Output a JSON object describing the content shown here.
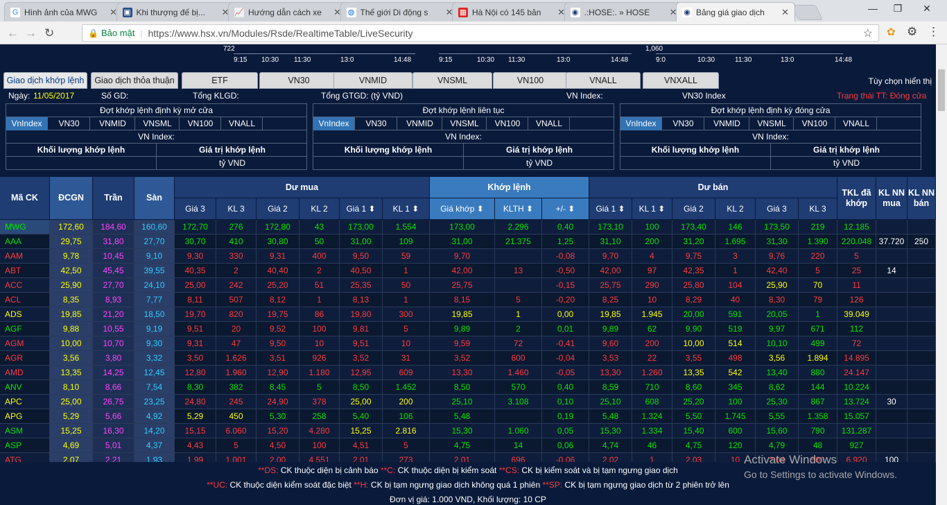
{
  "browser": {
    "tabs": [
      {
        "title": "Hình ảnh của MWG",
        "icon": "google-g-icon",
        "active": false
      },
      {
        "title": "Khi thượng đế bị...",
        "icon": "news-icon",
        "active": false
      },
      {
        "title": "Hướng dẫn cách xe",
        "icon": "chart-icon",
        "active": false
      },
      {
        "title": "Thế giới Di động s",
        "icon": "globe-icon",
        "active": false
      },
      {
        "title": "Hà Nội có 145 bản",
        "icon": "news-red-icon",
        "active": false
      },
      {
        "title": ".:HOSE:. » HOSE",
        "icon": "hose-icon",
        "active": false
      },
      {
        "title": "Bảng giá giao dịch",
        "icon": "hose-icon",
        "active": true
      }
    ],
    "security_label": "Bảo mật",
    "url": "https://www.hsx.vn/Modules/Rsde/RealtimeTable/LiveSecurity"
  },
  "charts": [
    {
      "ylabel": "722",
      "ticks": [
        "9:15",
        "10:30",
        "11:30",
        "13:0",
        "14:48"
      ]
    },
    {
      "ylabel": "",
      "ticks": [
        "9:15",
        "10:30",
        "11:30",
        "13:0",
        "14:48"
      ]
    },
    {
      "ylabel": "1,060",
      "ticks": [
        "9:0",
        "10:30",
        "11:30",
        "13:0",
        "14:48"
      ]
    }
  ],
  "index_tabs": [
    "Giao dịch khớp lệnh",
    "Giao dịch thỏa thuận",
    "ETF",
    "VN30",
    "VNMID",
    "VNSML",
    "VN100",
    "VNALL",
    "VNXALL"
  ],
  "display_options": "Tùy chọn hiển thị",
  "info": {
    "date_label": "Ngày:",
    "date_value": "11/05/2017",
    "session_label": "Số GD:",
    "total_vol_label": "Tổng KLGD:",
    "total_val_label": "Tổng GTGD:  (tỷ VND)",
    "vnindex_label": "VN Index:",
    "vn30_label": "VN30 Index",
    "market_status": "Trạng thái TT: Đóng cửa"
  },
  "periods": [
    {
      "title": "Đợt khớp lệnh định kỳ mở cửa"
    },
    {
      "title": "Đợt khớp lệnh liên tục"
    },
    {
      "title": "Đợt khớp lệnh định kỳ đóng cửa"
    }
  ],
  "period_tabs": [
    "VnIndex",
    "VN30",
    "VNMID",
    "VNSML",
    "VN100",
    "VNALL"
  ],
  "period_labels": {
    "index": "VN Index:",
    "vol": "Khối lượng khớp lệnh",
    "val": "Giá trị khớp lệnh",
    "unit": "tỷ VND"
  },
  "board": {
    "head": {
      "ma": "Mã CK",
      "dcgn": "ĐCGN",
      "tran": "Trần",
      "san": "Sàn",
      "dumua": "Dư mua",
      "khop": "Khớp lệnh",
      "duban": "Dư bán",
      "tkl": "TKL đã khớp",
      "nnmua": "KL NN mua",
      "nnban": "KL NN bán"
    },
    "subhead": [
      "Giá 3",
      "KL 3",
      "Giá 2",
      "KL 2",
      "Giá 1 ⬍",
      "KL 1 ⬍",
      "Giá khớp ⬍",
      "KLTH ⬍",
      "+/- ⬍",
      "Giá 1 ⬍",
      "KL 1 ⬍",
      "Giá 2",
      "KL 2",
      "Giá 3",
      "KL 3"
    ],
    "rows": [
      {
        "c": [
          "MWG",
          "172,60",
          "184,60",
          "160,60",
          "172,70",
          "276",
          "172,80",
          "43",
          "173,00",
          "1.554",
          "173,00",
          "2.296",
          "0,40",
          "173,10",
          "100",
          "173,40",
          "146",
          "173,50",
          "219",
          "12.185",
          "",
          ""
        ],
        "k": [
          "g",
          "y",
          "m",
          "c",
          "g",
          "g",
          "g",
          "g",
          "g",
          "g",
          "g",
          "g",
          "g",
          "g",
          "g",
          "g",
          "g",
          "g",
          "g",
          "g",
          "w",
          "w"
        ]
      },
      {
        "c": [
          "AAA",
          "29,75",
          "31,80",
          "27,70",
          "30,70",
          "410",
          "30,80",
          "50",
          "31,00",
          "109",
          "31,00",
          "21.375",
          "1,25",
          "31,10",
          "200",
          "31,20",
          "1.695",
          "31,30",
          "1.390",
          "220.048",
          "37.720",
          "250"
        ],
        "k": [
          "g",
          "y",
          "m",
          "c",
          "g",
          "g",
          "g",
          "g",
          "g",
          "g",
          "g",
          "g",
          "g",
          "g",
          "g",
          "g",
          "g",
          "g",
          "g",
          "g",
          "w",
          "w"
        ]
      },
      {
        "c": [
          "AAM",
          "9,78",
          "10,45",
          "9,10",
          "9,30",
          "330",
          "9,31",
          "400",
          "9,50",
          "59",
          "9,70",
          "",
          "-0,08",
          "9,70",
          "4",
          "9,75",
          "3",
          "9,76",
          "220",
          "5",
          "",
          ""
        ],
        "k": [
          "r",
          "y",
          "m",
          "c",
          "r",
          "r",
          "r",
          "r",
          "r",
          "r",
          "r",
          "r",
          "r",
          "r",
          "r",
          "r",
          "r",
          "r",
          "r",
          "r",
          "w",
          "w"
        ]
      },
      {
        "c": [
          "ABT",
          "42,50",
          "45,45",
          "39,55",
          "40,35",
          "2",
          "40,40",
          "2",
          "40,50",
          "1",
          "42,00",
          "13",
          "-0,50",
          "42,00",
          "97",
          "42,35",
          "1",
          "42,40",
          "5",
          "25",
          "14",
          ""
        ],
        "k": [
          "r",
          "y",
          "m",
          "c",
          "r",
          "r",
          "r",
          "r",
          "r",
          "r",
          "r",
          "r",
          "r",
          "r",
          "r",
          "r",
          "r",
          "r",
          "r",
          "r",
          "w",
          "w"
        ]
      },
      {
        "c": [
          "ACC",
          "25,90",
          "27,70",
          "24,10",
          "25,00",
          "242",
          "25,20",
          "51",
          "25,35",
          "50",
          "25,75",
          "",
          "-0,15",
          "25,75",
          "290",
          "25,80",
          "104",
          "25,90",
          "70",
          "11",
          "",
          ""
        ],
        "k": [
          "r",
          "y",
          "m",
          "c",
          "r",
          "r",
          "r",
          "r",
          "r",
          "r",
          "r",
          "r",
          "r",
          "r",
          "r",
          "r",
          "r",
          "y",
          "y",
          "r",
          "w",
          "w"
        ]
      },
      {
        "c": [
          "ACL",
          "8,35",
          "8,93",
          "7,77",
          "8,11",
          "507",
          "8,12",
          "1",
          "8,13",
          "1",
          "8,15",
          "5",
          "-0,20",
          "8,25",
          "10",
          "8,29",
          "40",
          "8,30",
          "79",
          "126",
          "",
          ""
        ],
        "k": [
          "r",
          "y",
          "m",
          "c",
          "r",
          "r",
          "r",
          "r",
          "r",
          "r",
          "r",
          "r",
          "r",
          "r",
          "r",
          "r",
          "r",
          "r",
          "r",
          "r",
          "w",
          "w"
        ]
      },
      {
        "c": [
          "ADS",
          "19,85",
          "21,20",
          "18,50",
          "19,70",
          "820",
          "19,75",
          "86",
          "19,80",
          "300",
          "19,85",
          "1",
          "0,00",
          "19,85",
          "1.945",
          "20,00",
          "591",
          "20,05",
          "1",
          "39.049",
          "",
          ""
        ],
        "k": [
          "y",
          "y",
          "m",
          "c",
          "r",
          "r",
          "r",
          "r",
          "r",
          "r",
          "y",
          "y",
          "y",
          "y",
          "y",
          "g",
          "g",
          "g",
          "g",
          "y",
          "w",
          "w"
        ]
      },
      {
        "c": [
          "AGF",
          "9,88",
          "10,55",
          "9,19",
          "9,51",
          "20",
          "9,52",
          "100",
          "9,81",
          "5",
          "9,89",
          "2",
          "0,01",
          "9,89",
          "62",
          "9,90",
          "519",
          "9,97",
          "671",
          "112",
          "",
          ""
        ],
        "k": [
          "g",
          "y",
          "m",
          "c",
          "r",
          "r",
          "r",
          "r",
          "r",
          "r",
          "g",
          "g",
          "g",
          "g",
          "g",
          "g",
          "g",
          "g",
          "g",
          "g",
          "w",
          "w"
        ]
      },
      {
        "c": [
          "AGM",
          "10,00",
          "10,70",
          "9,30",
          "9,31",
          "47",
          "9,50",
          "10",
          "9,51",
          "10",
          "9,59",
          "72",
          "-0,41",
          "9,60",
          "200",
          "10,00",
          "514",
          "10,10",
          "499",
          "72",
          "",
          ""
        ],
        "k": [
          "r",
          "y",
          "m",
          "c",
          "r",
          "r",
          "r",
          "r",
          "r",
          "r",
          "r",
          "r",
          "r",
          "r",
          "r",
          "y",
          "y",
          "g",
          "g",
          "r",
          "w",
          "w"
        ]
      },
      {
        "c": [
          "AGR",
          "3,56",
          "3,80",
          "3,32",
          "3,50",
          "1.626",
          "3,51",
          "926",
          "3,52",
          "31",
          "3,52",
          "600",
          "-0,04",
          "3,53",
          "22",
          "3,55",
          "498",
          "3,56",
          "1.894",
          "14.895",
          "",
          ""
        ],
        "k": [
          "r",
          "y",
          "m",
          "c",
          "r",
          "r",
          "r",
          "r",
          "r",
          "r",
          "r",
          "r",
          "r",
          "r",
          "r",
          "r",
          "r",
          "y",
          "y",
          "r",
          "w",
          "w"
        ]
      },
      {
        "c": [
          "AMD",
          "13,35",
          "14,25",
          "12,45",
          "12,80",
          "1.960",
          "12,90",
          "1.180",
          "12,95",
          "609",
          "13,30",
          "1.460",
          "-0,05",
          "13,30",
          "1.260",
          "13,35",
          "542",
          "13,40",
          "880",
          "24.147",
          "",
          ""
        ],
        "k": [
          "r",
          "y",
          "m",
          "c",
          "r",
          "r",
          "r",
          "r",
          "r",
          "r",
          "r",
          "r",
          "r",
          "r",
          "r",
          "y",
          "y",
          "g",
          "g",
          "r",
          "w",
          "w"
        ]
      },
      {
        "c": [
          "ANV",
          "8,10",
          "8,66",
          "7,54",
          "8,30",
          "382",
          "8,45",
          "5",
          "8,50",
          "1.452",
          "8,50",
          "570",
          "0,40",
          "8,59",
          "710",
          "8,60",
          "345",
          "8,62",
          "144",
          "10.224",
          "",
          ""
        ],
        "k": [
          "g",
          "y",
          "m",
          "c",
          "g",
          "g",
          "g",
          "g",
          "g",
          "g",
          "g",
          "g",
          "g",
          "g",
          "g",
          "g",
          "g",
          "g",
          "g",
          "g",
          "w",
          "w"
        ]
      },
      {
        "c": [
          "APC",
          "25,00",
          "26,75",
          "23,25",
          "24,80",
          "245",
          "24,90",
          "378",
          "25,00",
          "200",
          "25,10",
          "3.108",
          "0,10",
          "25,10",
          "608",
          "25,20",
          "100",
          "25,30",
          "867",
          "13.724",
          "30",
          ""
        ],
        "k": [
          "y",
          "y",
          "m",
          "c",
          "r",
          "r",
          "r",
          "r",
          "y",
          "y",
          "g",
          "g",
          "g",
          "g",
          "g",
          "g",
          "g",
          "g",
          "g",
          "g",
          "w",
          "w"
        ]
      },
      {
        "c": [
          "APG",
          "5,29",
          "5,66",
          "4,92",
          "5,29",
          "450",
          "5,30",
          "258",
          "5,40",
          "106",
          "5,48",
          "",
          "0,19",
          "5,48",
          "1.324",
          "5,50",
          "1.745",
          "5,55",
          "1.358",
          "15.057",
          "",
          ""
        ],
        "k": [
          "y",
          "y",
          "m",
          "c",
          "y",
          "y",
          "g",
          "g",
          "g",
          "g",
          "g",
          "g",
          "g",
          "g",
          "g",
          "g",
          "g",
          "g",
          "g",
          "g",
          "w",
          "w"
        ]
      },
      {
        "c": [
          "ASM",
          "15,25",
          "16,30",
          "14,20",
          "15,15",
          "6.060",
          "15,20",
          "4.280",
          "15,25",
          "2.816",
          "15,30",
          "1.060",
          "0,05",
          "15,30",
          "1.334",
          "15,40",
          "600",
          "15,60",
          "790",
          "131.287",
          "",
          ""
        ],
        "k": [
          "g",
          "y",
          "m",
          "c",
          "r",
          "r",
          "r",
          "r",
          "y",
          "y",
          "g",
          "g",
          "g",
          "g",
          "g",
          "g",
          "g",
          "g",
          "g",
          "g",
          "w",
          "w"
        ]
      },
      {
        "c": [
          "ASP",
          "4,69",
          "5,01",
          "4,37",
          "4,43",
          "5",
          "4,50",
          "100",
          "4,51",
          "5",
          "4,75",
          "14",
          "0,06",
          "4,74",
          "46",
          "4,75",
          "120",
          "4,79",
          "48",
          "927",
          "",
          ""
        ],
        "k": [
          "g",
          "y",
          "m",
          "c",
          "r",
          "r",
          "r",
          "r",
          "r",
          "r",
          "g",
          "g",
          "g",
          "g",
          "g",
          "g",
          "g",
          "g",
          "g",
          "g",
          "w",
          "w"
        ]
      },
      {
        "c": [
          "ATG",
          "2,07",
          "2,21",
          "1,93",
          "1,99",
          "1.001",
          "2,00",
          "4.551",
          "2,01",
          "273",
          "2,01",
          "696",
          "-0,06",
          "2,02",
          "1",
          "2,03",
          "10",
          "2,04",
          "500",
          "6.920",
          "100",
          ""
        ],
        "k": [
          "r",
          "y",
          "m",
          "c",
          "r",
          "r",
          "r",
          "r",
          "r",
          "r",
          "r",
          "r",
          "r",
          "r",
          "r",
          "r",
          "r",
          "r",
          "r",
          "r",
          "w",
          "w"
        ]
      }
    ]
  },
  "legend": {
    "l1": [
      {
        "m": "**DS:",
        "t": " CK thuộc diện bị cảnh báo "
      },
      {
        "m": "**C:",
        "t": " CK thuộc diện bị kiểm soát "
      },
      {
        "m": "**CS:",
        "t": " CK bị kiểm soát và bị tạm ngưng giao dịch"
      }
    ],
    "l2": [
      {
        "m": "**UC:",
        "t": " CK thuộc diện kiểm soát đặc biệt "
      },
      {
        "m": "**H:",
        "t": " CK bị tạm ngưng giao dịch không quá 1 phiên "
      },
      {
        "m": "**SP:",
        "t": " CK bị tạm ngưng giao dịch từ 2 phiên trở lên"
      }
    ],
    "l3": "Đơn vị giá: 1.000 VND, Khối lượng: 10 CP"
  },
  "watermark": {
    "line1": "Activate Windows",
    "line2": "Go to Settings to activate Windows."
  },
  "colors": {
    "green": "#00e600",
    "red": "#ff3b3b",
    "yellow": "#ffff00",
    "magenta": "#ff44ff",
    "cyan": "#33ccff",
    "white": "#ffffff",
    "header_dark": "#1f3c73",
    "header_light": "#3a7bbf"
  }
}
